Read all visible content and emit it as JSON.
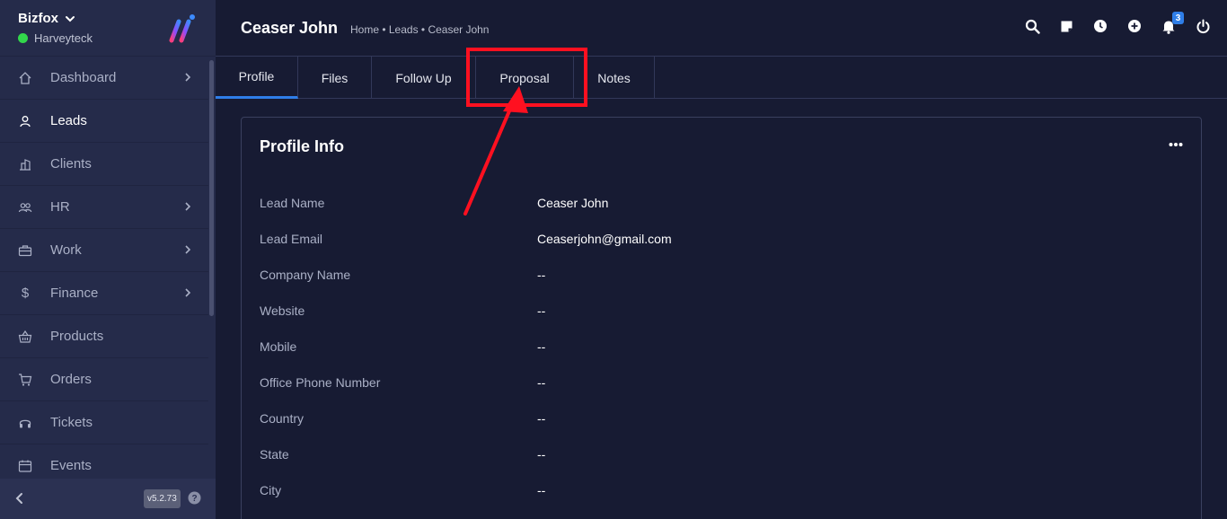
{
  "brand": {
    "name": "Bizfox",
    "workspace": "Harveyteck"
  },
  "sidebar": {
    "items": [
      {
        "label": "Dashboard",
        "icon": "home-icon",
        "has_chevron": true
      },
      {
        "label": "Leads",
        "icon": "user-icon",
        "has_chevron": false,
        "active": true
      },
      {
        "label": "Clients",
        "icon": "building-icon",
        "has_chevron": false
      },
      {
        "label": "HR",
        "icon": "users-icon",
        "has_chevron": true
      },
      {
        "label": "Work",
        "icon": "briefcase-icon",
        "has_chevron": true
      },
      {
        "label": "Finance",
        "icon": "dollar-icon",
        "has_chevron": true
      },
      {
        "label": "Products",
        "icon": "basket-icon",
        "has_chevron": false
      },
      {
        "label": "Orders",
        "icon": "cart-icon",
        "has_chevron": false
      },
      {
        "label": "Tickets",
        "icon": "headset-icon",
        "has_chevron": false
      },
      {
        "label": "Events",
        "icon": "calendar-icon",
        "has_chevron": false
      }
    ],
    "version": "v5.2.73"
  },
  "header": {
    "title": "Ceaser John",
    "breadcrumb": "Home • Leads • Ceaser John",
    "notification_count": "3"
  },
  "tabs": [
    {
      "label": "Profile",
      "active": true
    },
    {
      "label": "Files"
    },
    {
      "label": "Follow Up"
    },
    {
      "label": "Proposal"
    },
    {
      "label": "Notes"
    }
  ],
  "profile": {
    "title": "Profile Info",
    "rows": [
      {
        "label": "Lead Name",
        "value": "Ceaser John"
      },
      {
        "label": "Lead Email",
        "value": "Ceaserjohn@gmail.com"
      },
      {
        "label": "Company Name",
        "value": "--"
      },
      {
        "label": "Website",
        "value": "--"
      },
      {
        "label": "Mobile",
        "value": "--"
      },
      {
        "label": "Office Phone Number",
        "value": "--"
      },
      {
        "label": "Country",
        "value": "--"
      },
      {
        "label": "State",
        "value": "--"
      },
      {
        "label": "City",
        "value": "--"
      }
    ]
  },
  "colors": {
    "background": "#171b33",
    "sidebar": "#252b4a",
    "accent": "#2f7ee8",
    "status_online": "#32d74b",
    "annotation": "#ff1020"
  }
}
